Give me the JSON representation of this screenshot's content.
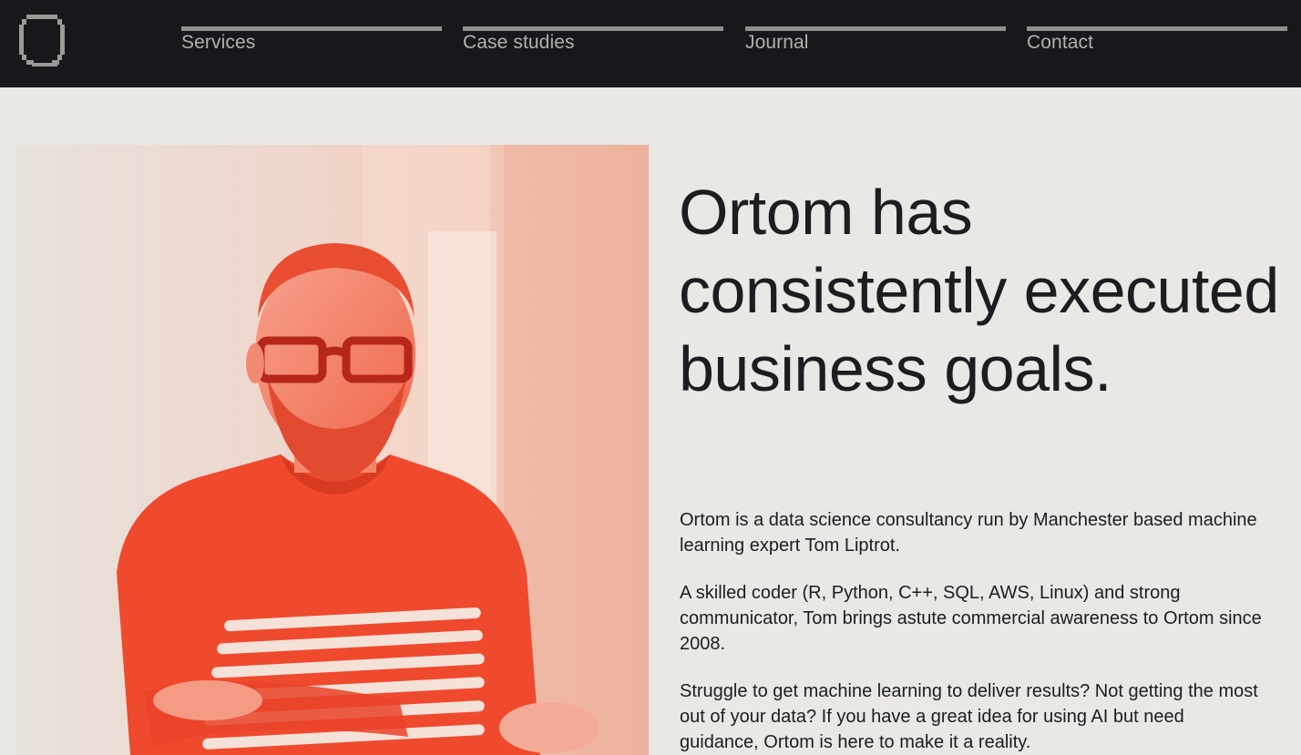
{
  "brand": {
    "logo_icon": "bracket-square-logo",
    "colors": {
      "header_bg": "#17181b",
      "page_bg": "#e9e8e4",
      "accent_red": "#f04a2f"
    }
  },
  "nav": {
    "items": [
      {
        "label": "Services"
      },
      {
        "label": "Case studies"
      },
      {
        "label": "Journal"
      },
      {
        "label": "Contact"
      }
    ]
  },
  "hero": {
    "photo_icon": "portrait-photo",
    "headline": "Ortom has consistently executed business goals.",
    "paragraphs": [
      "Ortom is a data science consultancy run by Manchester based machine learning expert Tom Liptrot.",
      "A skilled coder (R, Python, C++, SQL, AWS, Linux) and strong communicator, Tom brings astute commercial awareness to Ortom since 2008.",
      "Struggle to get machine learning to deliver results? Not getting the most out of your data? If you have a great idea for using AI but need guidance, Ortom is here to make it a reality."
    ]
  }
}
